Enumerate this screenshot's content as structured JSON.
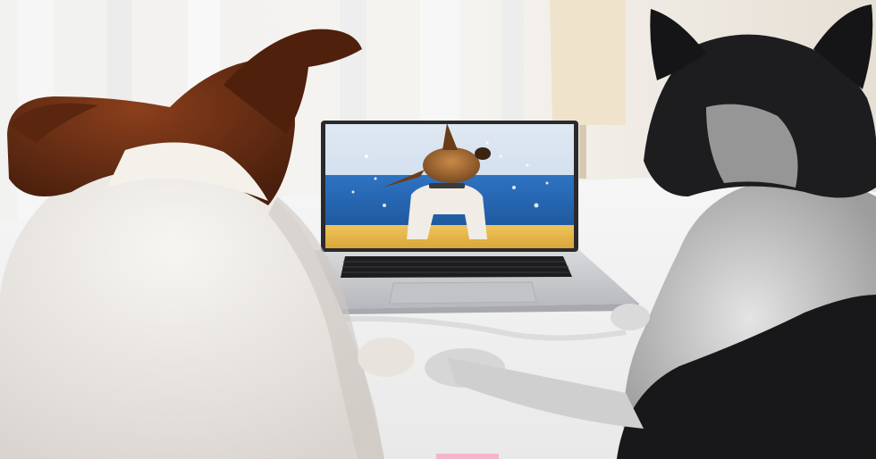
{
  "scene": {
    "subject": "two-dogs-watching-laptop",
    "palette": {
      "wall": "#ece7df",
      "curtain": "#f4f1ec",
      "lamp": "#efe3cc",
      "bed": "#f3f3f3",
      "laptop_body": "#c9cbcf",
      "screen_sky": "#cfdcec",
      "screen_sea": "#2f6fb7",
      "screen_sand": "#e8b94a",
      "left_dog_white": "#eeeae6",
      "left_dog_brown": "#6b2f14",
      "right_dog_black": "#1c1c1e",
      "right_dog_gray": "#b9b9b9"
    }
  }
}
